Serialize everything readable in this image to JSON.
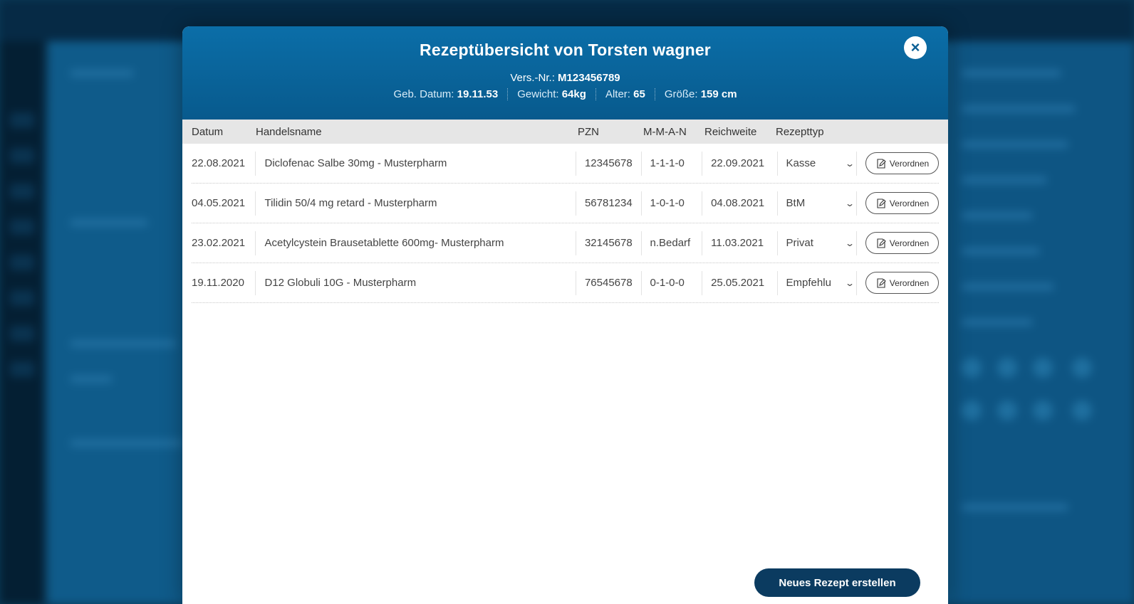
{
  "modal": {
    "title": "Rezeptübersicht von Torsten wagner",
    "close_icon": "×",
    "vers_label": "Vers.-Nr.:",
    "vers_value": "M123456789",
    "meta": [
      {
        "label": "Geb. Datum:",
        "value": "19.11.53"
      },
      {
        "label": "Gewicht:",
        "value": "64kg"
      },
      {
        "label": "Alter:",
        "value": "65"
      },
      {
        "label": "Größe:",
        "value": "159 cm"
      }
    ]
  },
  "table": {
    "headers": [
      "Datum",
      "Handelsname",
      "PZN",
      "M-M-A-N",
      "Reichweite",
      "Rezepttyp"
    ],
    "rows": [
      {
        "datum": "22.08.2021",
        "name": "Diclofenac Salbe 30mg - Musterpharm",
        "pzn": "12345678",
        "mman": "1-1-1-0",
        "reichweite": "22.09.2021",
        "typ": "Kasse",
        "action": "Verordnen"
      },
      {
        "datum": "04.05.2021",
        "name": "Tilidin 50/4 mg retard - Musterpharm",
        "pzn": "56781234",
        "mman": "1-0-1-0",
        "reichweite": "04.08.2021",
        "typ": "BtM",
        "action": "Verordnen"
      },
      {
        "datum": "23.02.2021",
        "name": "Acetylcystein Brausetablette 600mg- Musterpharm",
        "pzn": "32145678",
        "mman": "n.Bedarf",
        "reichweite": "11.03.2021",
        "typ": "Privat",
        "action": "Verordnen"
      },
      {
        "datum": "19.11.2020",
        "name": "D12 Globuli 10G - Musterpharm",
        "pzn": "76545678",
        "mman": "0-1-0-0",
        "reichweite": "25.05.2021",
        "typ": "Empfehlu",
        "action": "Verordnen"
      }
    ]
  },
  "footer": {
    "new_button": "Neues Rezept erstellen"
  },
  "icons": {
    "close": "close-icon",
    "dropdown": "chevron-down-icon",
    "prescribe": "edit-document-icon"
  },
  "colors": {
    "header_top": "#0b6ea8",
    "header_bottom": "#085a8d",
    "primary_button": "#0b3b60",
    "table_head_bg": "#e6e6e6"
  }
}
